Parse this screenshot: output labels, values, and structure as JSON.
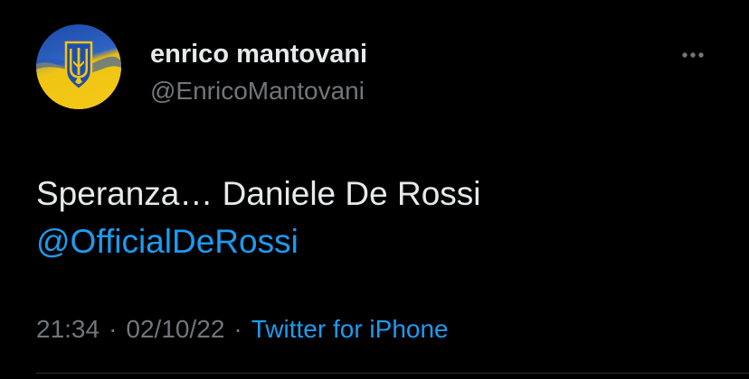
{
  "user": {
    "display_name": "enrico mantovani",
    "handle": "@EnricoMantovani",
    "avatar_icon": "ukraine-trident-flag-icon"
  },
  "tweet": {
    "text_line1": "Speranza… Daniele De Rossi",
    "mention": "@OfficialDeRossi"
  },
  "meta": {
    "time": "21:34",
    "separator": "·",
    "date": "02/10/22",
    "source": "Twitter for iPhone"
  },
  "icons": {
    "more": "more-horizontal-icon"
  },
  "colors": {
    "background": "#000000",
    "text_primary": "#e7e9ea",
    "text_secondary": "#71767b",
    "link": "#1d9bf0",
    "flag_blue": "#2455b8",
    "flag_yellow": "#f3c512"
  }
}
